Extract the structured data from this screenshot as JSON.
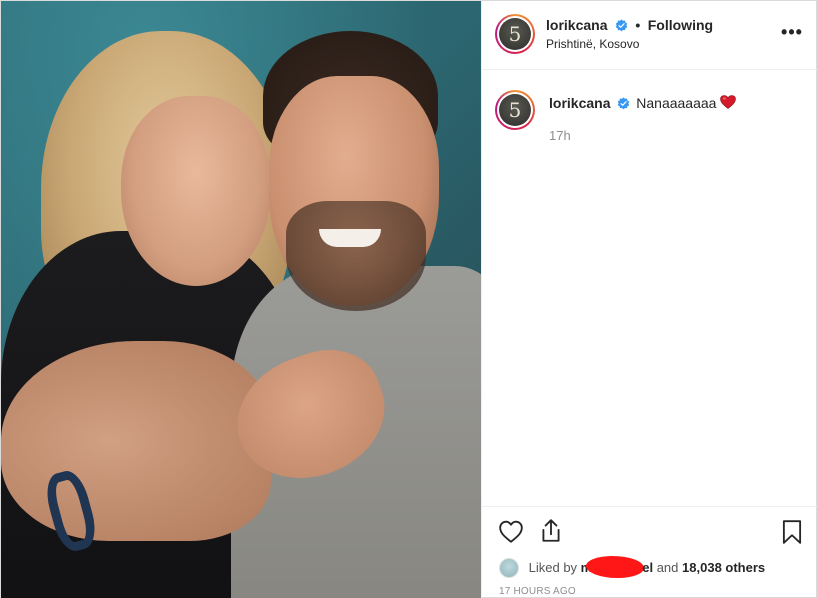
{
  "header": {
    "username": "lorikcana",
    "separator": "•",
    "follow_status": "Following",
    "location": "Prishtinë, Kosovo",
    "more_label": "•••",
    "avatar_text": "5"
  },
  "comment": {
    "username": "lorikcana",
    "caption": "Nanaaaaaaa",
    "time": "17h",
    "avatar_text": "5"
  },
  "actions": {
    "liked_prefix": "Liked by",
    "liker_start": "m",
    "liker_end": "el",
    "and": "and",
    "others": "18,038 others",
    "timestamp": "17 HOURS AGO"
  },
  "colors": {
    "verified": "#3897f0",
    "heart": "#ed4956",
    "redaction": "#ff1717"
  },
  "icons": [
    "verified-icon",
    "more-icon",
    "heart-emoji-icon",
    "like-icon",
    "share-icon",
    "save-icon"
  ]
}
